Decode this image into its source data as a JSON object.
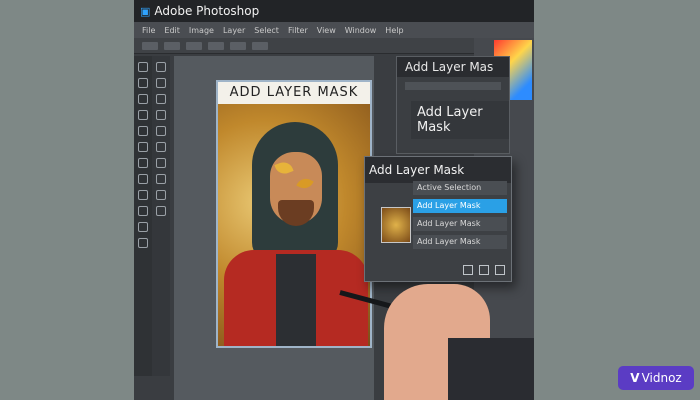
{
  "window": {
    "title": "Adobe Photoshop",
    "icon": "ps-logo-icon"
  },
  "menu": {
    "items": [
      "File",
      "Edit",
      "Image",
      "Layer",
      "Select",
      "Filter",
      "View",
      "Window",
      "Help"
    ]
  },
  "document": {
    "header_text": "ADD LAYER MASK"
  },
  "layers_panel": {
    "title": "Add Layer Mas",
    "button_label": "Add Layer Mask"
  },
  "dialog": {
    "title": "Add Layer Mask",
    "items": [
      {
        "label": "Active Selection",
        "selected": false
      },
      {
        "label": "Add Layer Mask",
        "selected": true
      },
      {
        "label": "Add Layer Mask",
        "selected": false
      },
      {
        "label": "Add Layer Mask",
        "selected": false
      }
    ]
  },
  "branding": {
    "logo_text": "Vidnoz",
    "logo_mark": "V"
  },
  "colors": {
    "accent": "#2aa0e6",
    "background": "#7c8583",
    "screen": "#3a3d41",
    "logo": "#5b3cc4"
  }
}
